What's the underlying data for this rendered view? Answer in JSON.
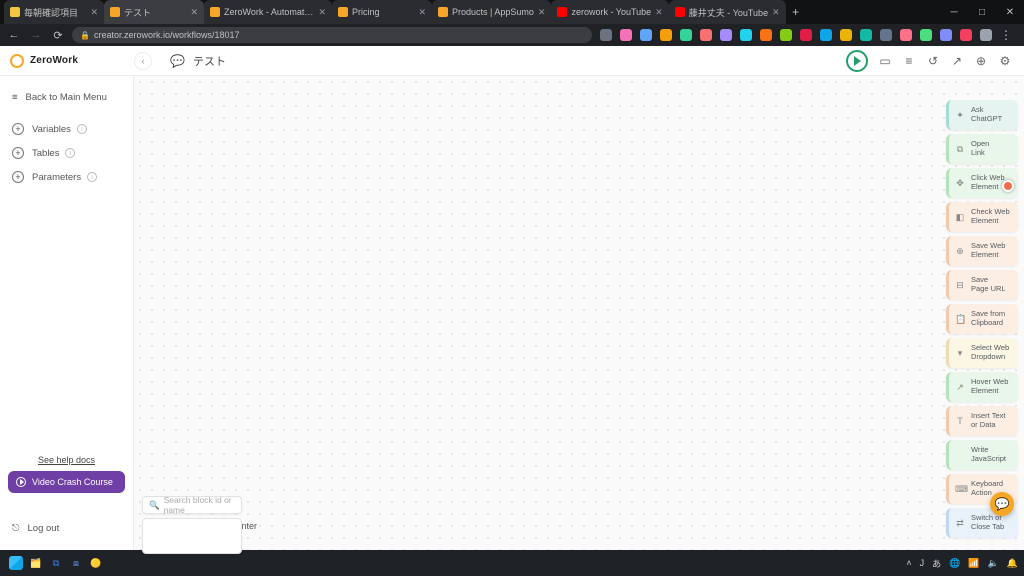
{
  "browser": {
    "tabs": [
      {
        "favicon": "fav-folder",
        "title": "毎朝確認項目"
      },
      {
        "favicon": "fav-zw",
        "title": "テスト",
        "active": true
      },
      {
        "favicon": "fav-zw",
        "title": "ZeroWork - Automate repetiti…"
      },
      {
        "favicon": "fav-zw",
        "title": "Pricing"
      },
      {
        "favicon": "fav-as",
        "title": "Products | AppSumo"
      },
      {
        "favicon": "fav-yt",
        "title": "zerowork - YouTube"
      },
      {
        "favicon": "fav-yt",
        "title": "藤井丈夫 - YouTube"
      }
    ],
    "url": "creator.zerowork.io/workflows/18017"
  },
  "app": {
    "brand": "ZeroWork",
    "workflow_title": "テスト",
    "sidebar": {
      "back": "Back to Main Menu",
      "items": [
        "Variables",
        "Tables",
        "Parameters"
      ],
      "help": "See help docs",
      "crash": "Video Crash Course",
      "logout": "Log out"
    },
    "canvas": {
      "search_placeholder": "Search block id or name",
      "zoom_center": "center"
    },
    "palette": [
      {
        "tint": "t-teal",
        "icon": "✦",
        "l1": "Ask",
        "l2": "ChatGPT"
      },
      {
        "tint": "t-green",
        "icon": "⧉",
        "l1": "Open",
        "l2": "Link"
      },
      {
        "tint": "t-green",
        "icon": "✥",
        "l1": "Click Web",
        "l2": "Element",
        "cursor": true
      },
      {
        "tint": "t-orange",
        "icon": "◧",
        "l1": "Check Web",
        "l2": "Element"
      },
      {
        "tint": "t-orange",
        "icon": "⊕",
        "l1": "Save Web",
        "l2": "Element"
      },
      {
        "tint": "t-orange",
        "icon": "⊟",
        "l1": "Save",
        "l2": "Page URL"
      },
      {
        "tint": "t-orange",
        "icon": "📋",
        "l1": "Save from",
        "l2": "Clipboard"
      },
      {
        "tint": "t-yellow",
        "icon": "▾",
        "l1": "Select Web",
        "l2": "Dropdown"
      },
      {
        "tint": "t-green",
        "icon": "↗",
        "l1": "Hover Web",
        "l2": "Element"
      },
      {
        "tint": "t-orange",
        "icon": "T",
        "l1": "Insert Text",
        "l2": "or Data"
      },
      {
        "tint": "t-green",
        "icon": "</>",
        "l1": "Write",
        "l2": "JavaScript"
      },
      {
        "tint": "t-orange",
        "icon": "⌨",
        "l1": "Keyboard",
        "l2": "Action"
      },
      {
        "tint": "t-blue",
        "icon": "⇄",
        "l1": "Switch or",
        "l2": "Close Tab"
      }
    ]
  },
  "taskbar": {
    "lang": "J",
    "ime": "あ",
    "clock": ""
  }
}
